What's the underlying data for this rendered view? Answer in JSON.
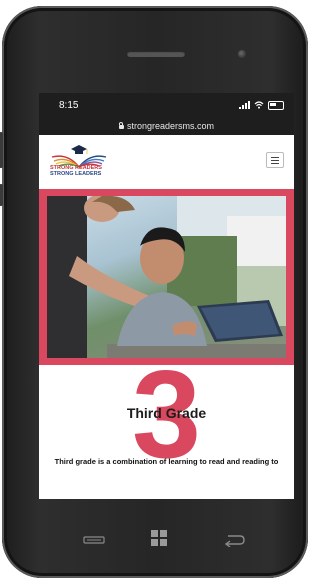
{
  "status_bar": {
    "time": "8:15"
  },
  "browser": {
    "url": "strongreadersms.com"
  },
  "site": {
    "logo_line1": "STRONG READERS",
    "logo_line2": "STRONG LEADERS",
    "menu_icon": "hamburger-icon"
  },
  "hero": {
    "image": "adult-helping-child-with-tablet-photo"
  },
  "grade": {
    "number": "3",
    "title": "Third Grade",
    "description": "Third grade is a combination of learning to read and reading to"
  },
  "icons": {
    "back": "back-arrow-icon",
    "home": "windows-icon",
    "search": "search-icon"
  },
  "colors": {
    "accent": "#d9485e",
    "logo_red": "#c8353c",
    "logo_blue": "#2a4a84",
    "status_bar_bg": "#1e1e1e"
  }
}
